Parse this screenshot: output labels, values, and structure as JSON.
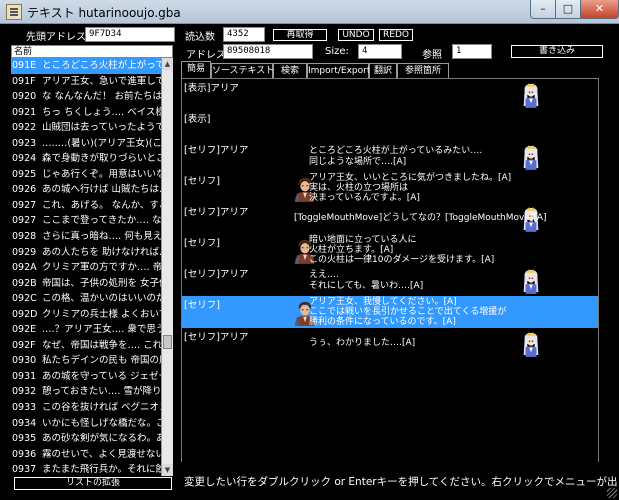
{
  "window": {
    "title": "テキスト hutarinooujo.gba",
    "minimize": "–",
    "maximize": "□",
    "close": "✕"
  },
  "toolbar": {
    "head_address_label": "先頭アドレス",
    "head_address_value": "9F7D34",
    "load_count_label": "読込数",
    "load_count_value": "4352",
    "reload_button": "再取得",
    "undo_button": "UNDO",
    "redo_button": "REDO",
    "address_label": "アドレス",
    "address_value": "89508018",
    "size_label": "Size:",
    "size_value": "4",
    "ref_label": "参照",
    "ref_value": "1",
    "write_button": "書き込み"
  },
  "list": {
    "header": "名前",
    "expand_button": "リストの拡張",
    "rows": [
      {
        "id": "091E",
        "text": "ところどころ火柱が上がっているみ",
        "selected": true
      },
      {
        "id": "091F",
        "text": "アリア王女、急いで進軍してくださ"
      },
      {
        "id": "0920",
        "text": "な なんなんだ！ お前たちは！"
      },
      {
        "id": "0921",
        "text": "ちっ ちくしょう‥‥ ベイス様、すま"
      },
      {
        "id": "0922",
        "text": "山賊団は去っていったようです。"
      },
      {
        "id": "0923",
        "text": "‥‥‥‥(暑い)(アリア王女)(ここも"
      },
      {
        "id": "0924",
        "text": "森で身動きが取りづらいところに"
      },
      {
        "id": "0925",
        "text": "じゃあ行くぞ。用意はいいな アリ"
      },
      {
        "id": "0926",
        "text": "あの城へ行けば 山賊たちは…"
      },
      {
        "id": "0927",
        "text": "これ、あげる。 なんか、すごいもの"
      },
      {
        "id": "0927",
        "text": "ここまで登ってきたか‥‥ ならばこ"
      },
      {
        "id": "0928",
        "text": "さらに真っ暗ね‥‥ 何も見えない"
      },
      {
        "id": "0929",
        "text": "あの人たちを 助けなければ‥‥ ま"
      },
      {
        "id": "092A",
        "text": "クリミア軍の方ですか‥‥ 帝国は"
      },
      {
        "id": "092B",
        "text": "帝国は、子供の処刑を 女子供まで"
      },
      {
        "id": "092C",
        "text": "この格、温かいのはいいのだが‥‥"
      },
      {
        "id": "092D",
        "text": "クリミアの兵士様 よくおいでくださ"
      },
      {
        "id": "092E",
        "text": "‥‥？アリア王女‥‥ 衆で思うな"
      },
      {
        "id": "092F",
        "text": "なぜ、帝国は戦争を‥‥ これをお"
      },
      {
        "id": "0930",
        "text": "私たちデインの民も 帝国の圧政に"
      },
      {
        "id": "0931",
        "text": "あの城を守っている ジェゼールと"
      },
      {
        "id": "0932",
        "text": "憩っておきたい‥‥ 雪が降りそう"
      },
      {
        "id": "0933",
        "text": "この谷を抜ければ ベグニオン帝国"
      },
      {
        "id": "0934",
        "text": "いかにも怪しげな橋だな。このマ"
      },
      {
        "id": "0935",
        "text": "あの砂な剣が気になるわ。あれは"
      },
      {
        "id": "0936",
        "text": "霧のせいで、よく見渡せないな。ま"
      },
      {
        "id": "0937",
        "text": "またまた飛行兵か。それに飲料す"
      },
      {
        "id": "0938",
        "text": "この海賊、陸を奪ってください"
      }
    ]
  },
  "tabs": [
    "簡易",
    "ソーステキスト",
    "検索",
    "Import/Export",
    "翻訳",
    "参照箇所"
  ],
  "preview": {
    "blocks": [
      {
        "tag": "[表示]アリア",
        "lines": [],
        "speaker": "aria"
      },
      {
        "tag": "[表示]",
        "lines": [],
        "speaker": "none"
      },
      {
        "tag": "[セリフ]アリア",
        "lines": [
          "ところどころ火柱が上がっているみたい‥‥",
          "同じような場所で‥‥[A]"
        ],
        "speaker": "aria"
      },
      {
        "tag": "[セリフ]",
        "lines": [
          "アリア王女、いいところに気がつきましたね。[A]",
          "実は、火柱の立つ場所は",
          "決まっているんですよ。[A]"
        ],
        "speaker": "man"
      },
      {
        "tag": "[セリフ]アリア",
        "lines": [
          "[ToggleMouthMove]どうしてなの？[ToggleMouthMove][A]"
        ],
        "speaker": "aria"
      },
      {
        "tag": "[セリフ]",
        "lines": [
          "暗い地面に立っている人に",
          "火柱が立ちます。[A]",
          "この火柱は一律10のダメージを受けます。[A]"
        ],
        "speaker": "man"
      },
      {
        "tag": "[セリフ]アリア",
        "lines": [
          "ええ‥‥",
          "それにしても、暑いわ‥‥[A]"
        ],
        "speaker": "aria"
      },
      {
        "tag": "[セリフ]",
        "lines": [
          "アリア王女、我慢してください。[A]",
          "ここでは戦いを長引かせることで出てくる増援が",
          "勝利の条件になっているのです。[A]"
        ],
        "speaker": "man",
        "highlight": true
      },
      {
        "tag": "[セリフ]アリア",
        "lines": [
          "うぅ、わかりました‥‥[A]"
        ],
        "speaker": "aria"
      }
    ]
  },
  "status": "変更したい行をダブルクリック or Enterキーを押してください。右クリックでメニューが出ます。",
  "colors": {
    "selection": "#3399ff",
    "background": "#000000"
  }
}
